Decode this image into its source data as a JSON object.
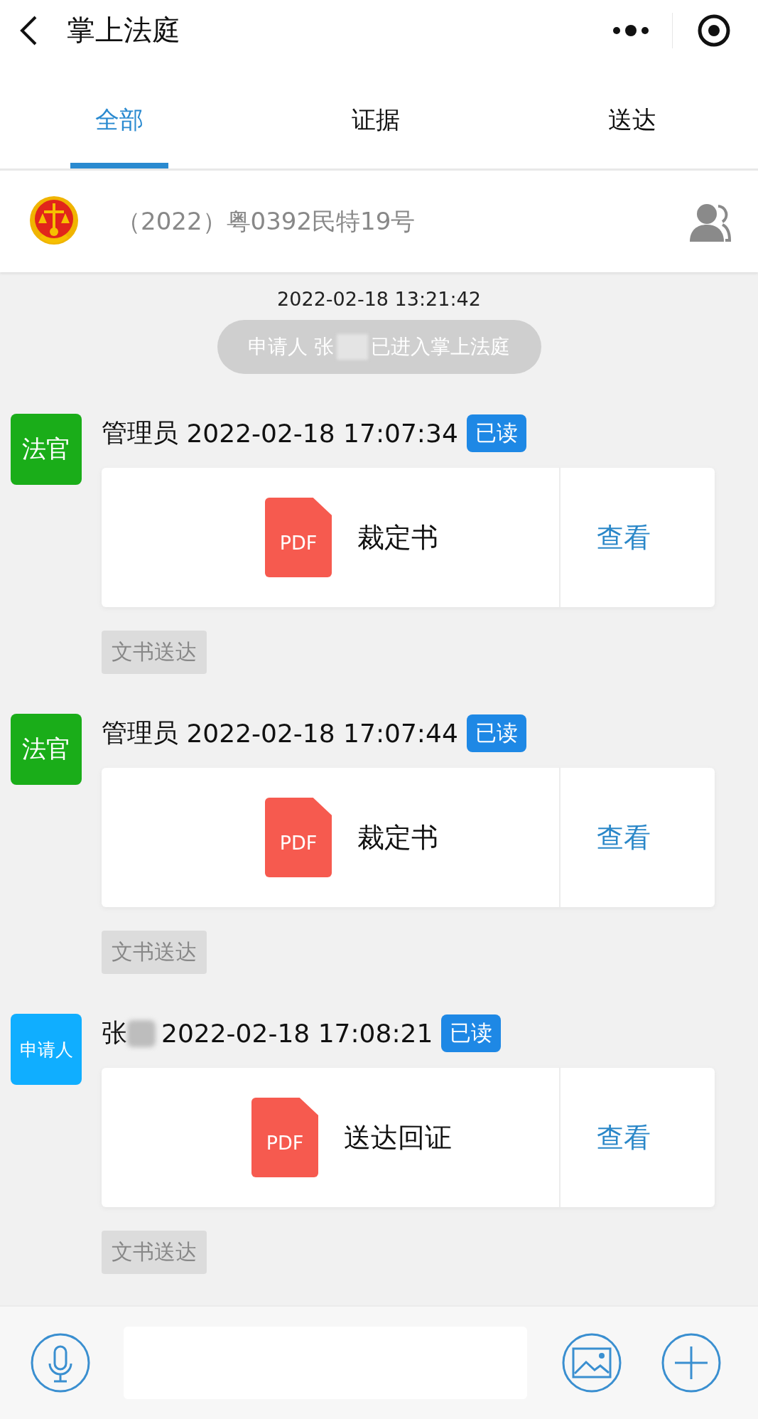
{
  "header": {
    "title": "掌上法庭"
  },
  "tabs": [
    {
      "label": "全部",
      "selected": true
    },
    {
      "label": "证据",
      "selected": false
    },
    {
      "label": "送达",
      "selected": false
    }
  ],
  "case": {
    "number": "（2022）粤0392民特19号"
  },
  "chat": {
    "time": "2022-02-18 13:21:42",
    "notice_before": "申请人 张",
    "notice_after": "已进入掌上法庭"
  },
  "messages": [
    {
      "role": "法官",
      "color": "#1aad19",
      "sender": "管理员",
      "sender_redacted": false,
      "time": "2022-02-18 17:07:34",
      "status": "已读",
      "file_type": "PDF",
      "file": "裁定书",
      "action": "查看",
      "tag": "文书送达"
    },
    {
      "role": "法官",
      "color": "#1aad19",
      "sender": "管理员",
      "sender_redacted": false,
      "time": "2022-02-18 17:07:44",
      "status": "已读",
      "file_type": "PDF",
      "file": "裁定书",
      "action": "查看",
      "tag": "文书送达"
    },
    {
      "role": "申请人",
      "color": "#10aeff",
      "sender": "张",
      "sender_redacted": true,
      "time": "2022-02-18 17:08:21",
      "status": "已读",
      "file_type": "PDF",
      "file": "送达回证",
      "action": "查看",
      "tag": "文书送达"
    }
  ]
}
